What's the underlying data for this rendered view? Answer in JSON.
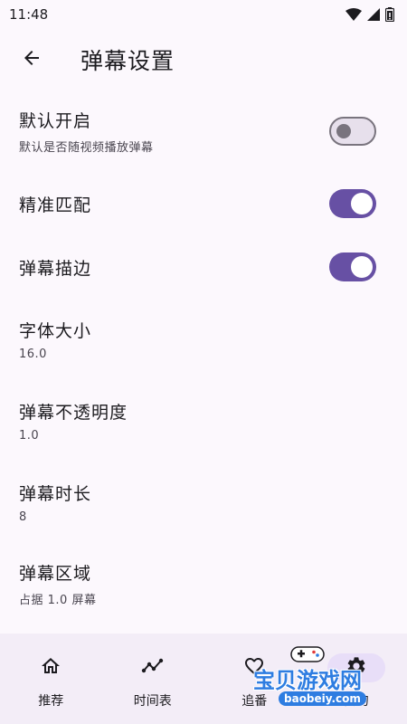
{
  "status_bar": {
    "time": "11:48",
    "icons": [
      "wifi-icon",
      "signal-icon",
      "battery-icon"
    ]
  },
  "app_bar": {
    "back_icon": "arrow-back-icon",
    "title": "弹幕设置"
  },
  "settings": [
    {
      "title": "默认开启",
      "subtitle": "默认是否随视频播放弹幕",
      "toggle": "off"
    },
    {
      "title": "精准匹配",
      "toggle": "on"
    },
    {
      "title": "弹幕描边",
      "toggle": "on"
    },
    {
      "title": "字体大小",
      "subtitle": "16.0"
    },
    {
      "title": "弹幕不透明度",
      "subtitle": "1.0"
    },
    {
      "title": "弹幕时长",
      "subtitle": "8"
    },
    {
      "title": "弹幕区域",
      "subtitle": "占据 1.0 屏幕"
    }
  ],
  "nav": {
    "items": [
      {
        "label": "推荐",
        "icon": "home-icon"
      },
      {
        "label": "时间表",
        "icon": "timeline-icon"
      },
      {
        "label": "追番",
        "icon": "heart-icon"
      },
      {
        "label": "我的",
        "icon": "gear-icon",
        "active": true
      }
    ]
  },
  "watermark": {
    "text": "宝贝游戏网",
    "url": "baobeiy.com"
  },
  "colors": {
    "background": "#fcf8fd",
    "accent": "#6750a4",
    "nav_background": "#f3edf7",
    "active_indicator": "#e8def8"
  }
}
